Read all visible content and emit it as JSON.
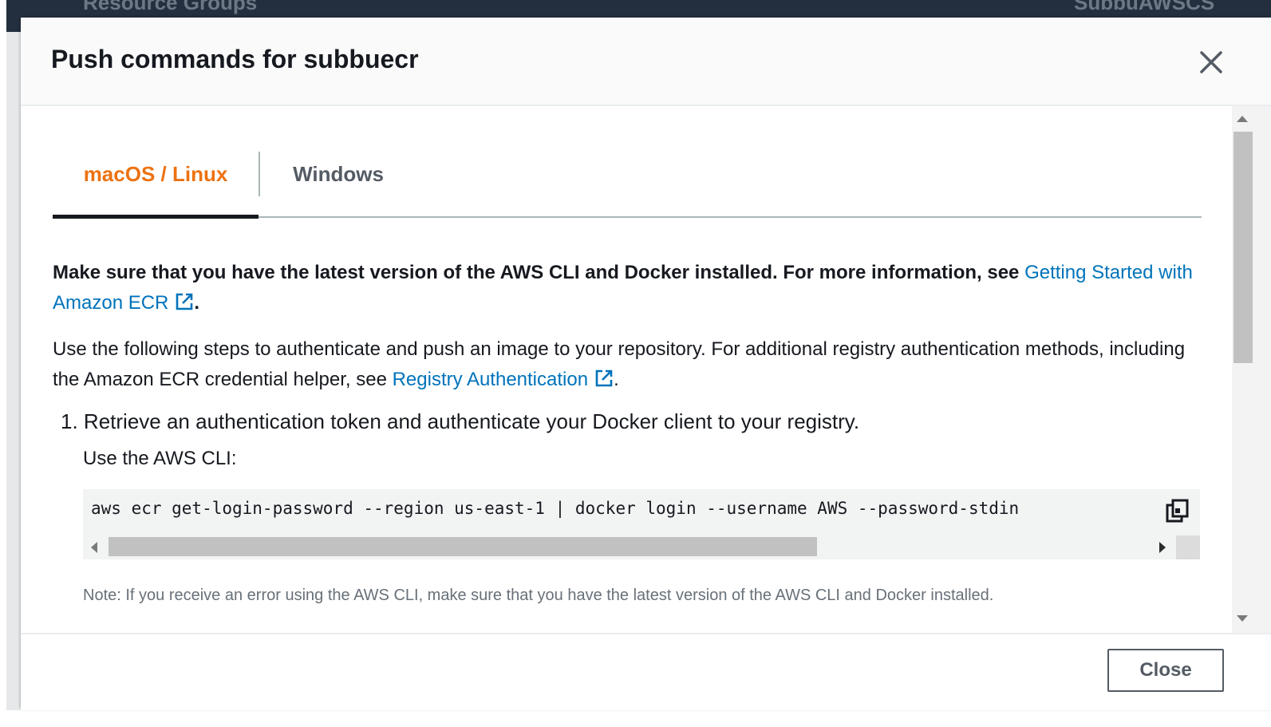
{
  "background": {
    "left_text": "Resource Groups",
    "right_text": "SubbuAWSCS"
  },
  "modal": {
    "title": "Push commands for subbuecr",
    "close_icon": "close-icon"
  },
  "tabs": [
    {
      "label": "macOS / Linux",
      "active": true
    },
    {
      "label": "Windows",
      "active": false
    }
  ],
  "intro": {
    "bold_text": "Make sure that you have the latest version of the AWS CLI and Docker installed. For more information, see ",
    "link": "Getting Started with Amazon ECR",
    "period": "."
  },
  "steps_intro": {
    "text": "Use the following steps to authenticate and push an image to your repository. For additional registry authentication methods, including the Amazon ECR credential helper, see ",
    "link": "Registry Authentication",
    "period": "."
  },
  "step1": {
    "number": "1.",
    "text": "Retrieve an authentication token and authenticate your Docker client to your registry.",
    "sub": "Use the AWS CLI:",
    "command": "aws ecr get-login-password --region us-east-1 | docker login --username AWS --password-stdin",
    "copy_icon": "copy-icon",
    "note": "Note: If you receive an error using the AWS CLI, make sure that you have the latest version of the AWS CLI and Docker installed."
  },
  "footer": {
    "close_label": "Close"
  },
  "colors": {
    "active_tab": "#ec7211",
    "link": "#0073bb",
    "text": "#16191f",
    "muted": "#687078"
  }
}
